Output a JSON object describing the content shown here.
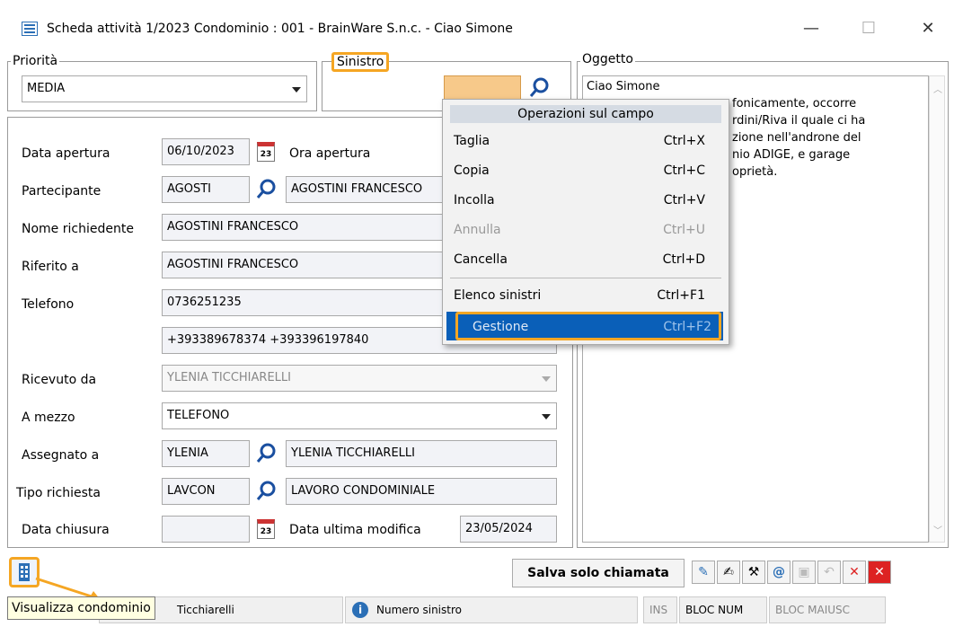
{
  "window": {
    "title": "Scheda attività 1/2023 Condominio : 001 - BrainWare S.n.c. - Ciao Simone",
    "minimize": "—",
    "maximize": "☐",
    "close": "✕"
  },
  "priority": {
    "legend": "Priorità",
    "value": "MEDIA"
  },
  "sinistro": {
    "legend": "Sinistro",
    "value": ""
  },
  "oggetto": {
    "legend": "Oggetto",
    "lines": [
      "Ciao Simone",
      "fonicamente, occorre",
      "rdini/Riva il quale ci ha",
      "zione nell'androne del",
      "nio ADIGE, e garage",
      "oprietà."
    ]
  },
  "form": {
    "data_apertura_label": "Data apertura",
    "data_apertura": "06/10/2023",
    "ora_apertura_label": "Ora apertura",
    "partecipante_label": "Partecipante",
    "partecipante_code": "AGOSTI",
    "partecipante_name": "AGOSTINI FRANCESCO",
    "nome_richiedente_label": "Nome richiedente",
    "nome_richiedente": "AGOSTINI FRANCESCO",
    "riferito_label": "Riferito a",
    "riferito": "AGOSTINI FRANCESCO",
    "telefono_label": "Telefono",
    "telefono": "0736251235",
    "telefono2": "+393389678374 +393396197840",
    "ricevuto_label": "Ricevuto da",
    "ricevuto": "YLENIA TICCHIARELLI",
    "mezzo_label": "A mezzo",
    "mezzo": "TELEFONO",
    "assegnato_label": "Assegnato a",
    "assegnato_code": "YLENIA",
    "assegnato_name": "YLENIA TICCHIARELLI",
    "tipo_label": "Tipo richiesta",
    "tipo_code": "LAVCON",
    "tipo_name": "LAVORO CONDOMINIALE",
    "chiusura_label": "Data chiusura",
    "chiusura": "",
    "ultima_mod_label": "Data ultima modifica",
    "ultima_mod": "23/05/2024"
  },
  "context_menu": {
    "header": "Operazioni sul campo",
    "items": [
      {
        "label": "Taglia",
        "shortcut": "Ctrl+X"
      },
      {
        "label": "Copia",
        "shortcut": "Ctrl+C"
      },
      {
        "label": "Incolla",
        "shortcut": "Ctrl+V"
      },
      {
        "label": "Annulla",
        "shortcut": "Ctrl+U"
      },
      {
        "label": "Cancella",
        "shortcut": "Ctrl+D"
      },
      {
        "label": "Elenco sinistri",
        "shortcut": "Ctrl+F1"
      },
      {
        "label": "Gestione",
        "shortcut": "Ctrl+F2"
      }
    ]
  },
  "toolbar": {
    "save_label": "Salva solo chiamata"
  },
  "tooltip": "Visualizza condominio",
  "status": {
    "user": "Ticchiarelli",
    "info": "Numero sinistro",
    "ins": "INS",
    "num": "BLOC NUM",
    "caps": "BLOC MAIUSC"
  },
  "colors": {
    "highlight": "#f5a623",
    "menu_selected": "#0a5fb8",
    "sinistro_field": "#f7c98a"
  }
}
